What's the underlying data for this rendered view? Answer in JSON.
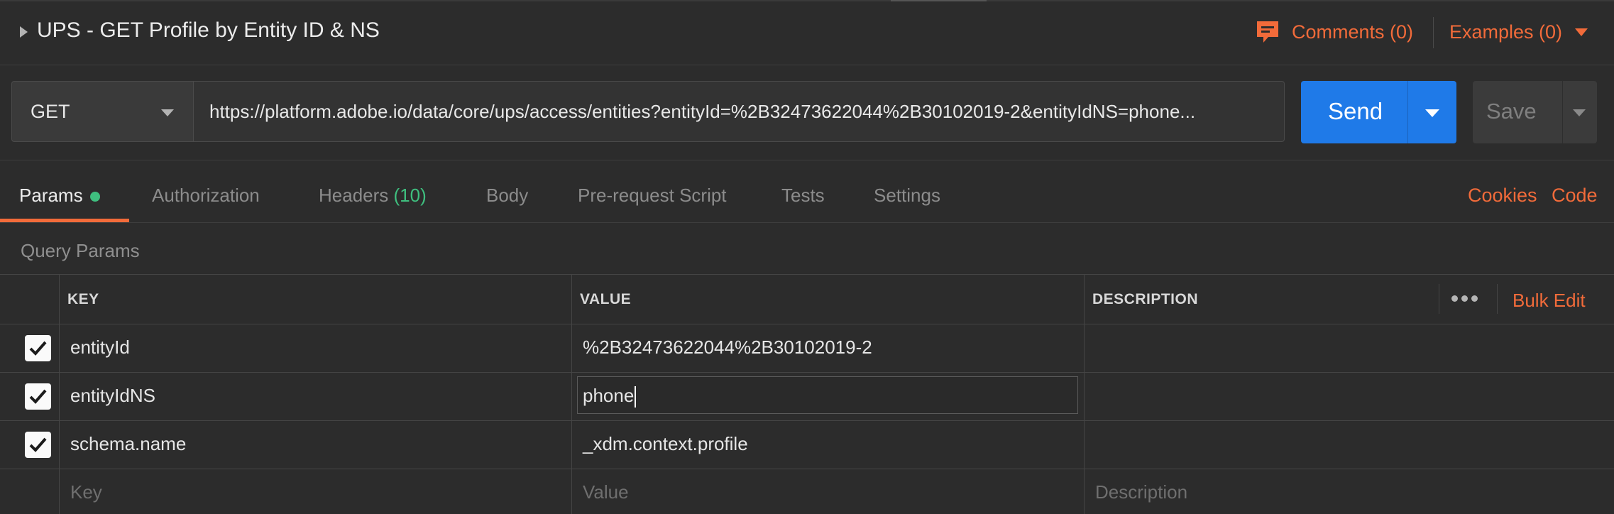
{
  "header": {
    "title": "UPS - GET Profile by Entity ID & NS",
    "comments_label": "Comments (0)",
    "examples_label": "Examples (0)"
  },
  "request": {
    "method": "GET",
    "url": "https://platform.adobe.io/data/core/ups/access/entities?entityId=%2B32473622044%2B30102019-2&entityIdNS=phone...",
    "send_label": "Send",
    "save_label": "Save"
  },
  "tabs": {
    "params": "Params",
    "authorization": "Authorization",
    "headers": "Headers",
    "headers_count": "(10)",
    "body": "Body",
    "prerequest": "Pre-request Script",
    "tests": "Tests",
    "settings": "Settings",
    "cookies": "Cookies",
    "code": "Code"
  },
  "query_params": {
    "section_title": "Query Params",
    "columns": {
      "key": "KEY",
      "value": "VALUE",
      "description": "DESCRIPTION"
    },
    "bulk_edit_label": "Bulk Edit",
    "rows": [
      {
        "checked": true,
        "key": "entityId",
        "value": "%2B32473622044%2B30102019-2",
        "description": ""
      },
      {
        "checked": true,
        "key": "entityIdNS",
        "value": "phone",
        "description": ""
      },
      {
        "checked": true,
        "key": "schema.name",
        "value": "_xdm.context.profile",
        "description": ""
      }
    ],
    "placeholders": {
      "key": "Key",
      "value": "Value",
      "description": "Description"
    }
  },
  "colors": {
    "accent": "#f26b3a",
    "send": "#1f7ae8",
    "active_dot": "#3fbf7f"
  }
}
